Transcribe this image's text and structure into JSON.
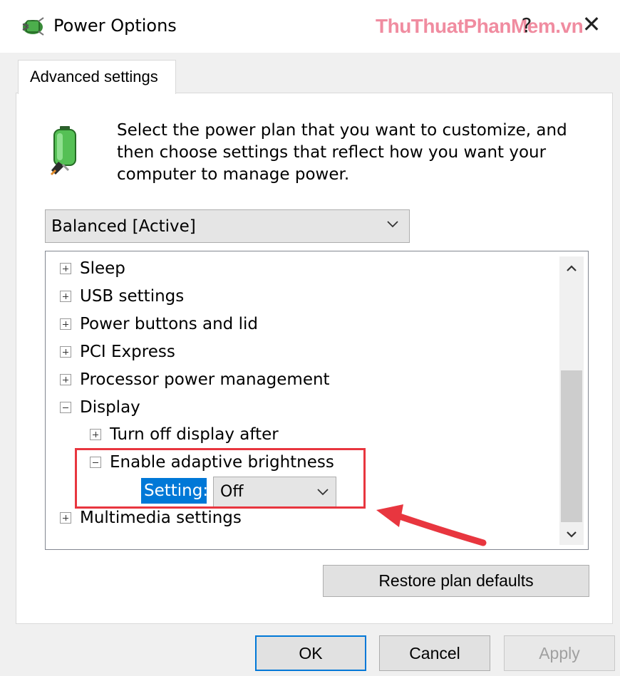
{
  "window": {
    "title": "Power Options",
    "watermark": "ThuThuatPhanMem.vn",
    "help_label": "?",
    "close_label": "✕",
    "icons": {
      "app": "power-options-icon",
      "help": "help-icon",
      "close": "close-icon"
    }
  },
  "tab": {
    "label": "Advanced settings"
  },
  "description": "Select the power plan that you want to customize, and then choose settings that reflect how you want your computer to manage power.",
  "plan_select": {
    "value": "Balanced [Active]",
    "icon": "chevron-down-icon"
  },
  "tree": {
    "items": [
      {
        "label": "Sleep",
        "expanded": false,
        "level": 0
      },
      {
        "label": "USB settings",
        "expanded": false,
        "level": 0
      },
      {
        "label": "Power buttons and lid",
        "expanded": false,
        "level": 0
      },
      {
        "label": "PCI Express",
        "expanded": false,
        "level": 0
      },
      {
        "label": "Processor power management",
        "expanded": false,
        "level": 0
      },
      {
        "label": "Display",
        "expanded": true,
        "level": 0
      },
      {
        "label": "Turn off display after",
        "expanded": false,
        "level": 1
      },
      {
        "label": "Enable adaptive brightness",
        "expanded": true,
        "level": 1
      },
      {
        "label": "Multimedia settings",
        "expanded": false,
        "level": 0
      }
    ],
    "setting": {
      "label": "Setting:",
      "value": "Off"
    }
  },
  "colors": {
    "highlight": "#e8363f",
    "accent": "#0078d7",
    "dialog_bg": "#f0f0f0"
  },
  "buttons": {
    "restore": "Restore plan defaults",
    "ok": "OK",
    "cancel": "Cancel",
    "apply": "Apply"
  }
}
